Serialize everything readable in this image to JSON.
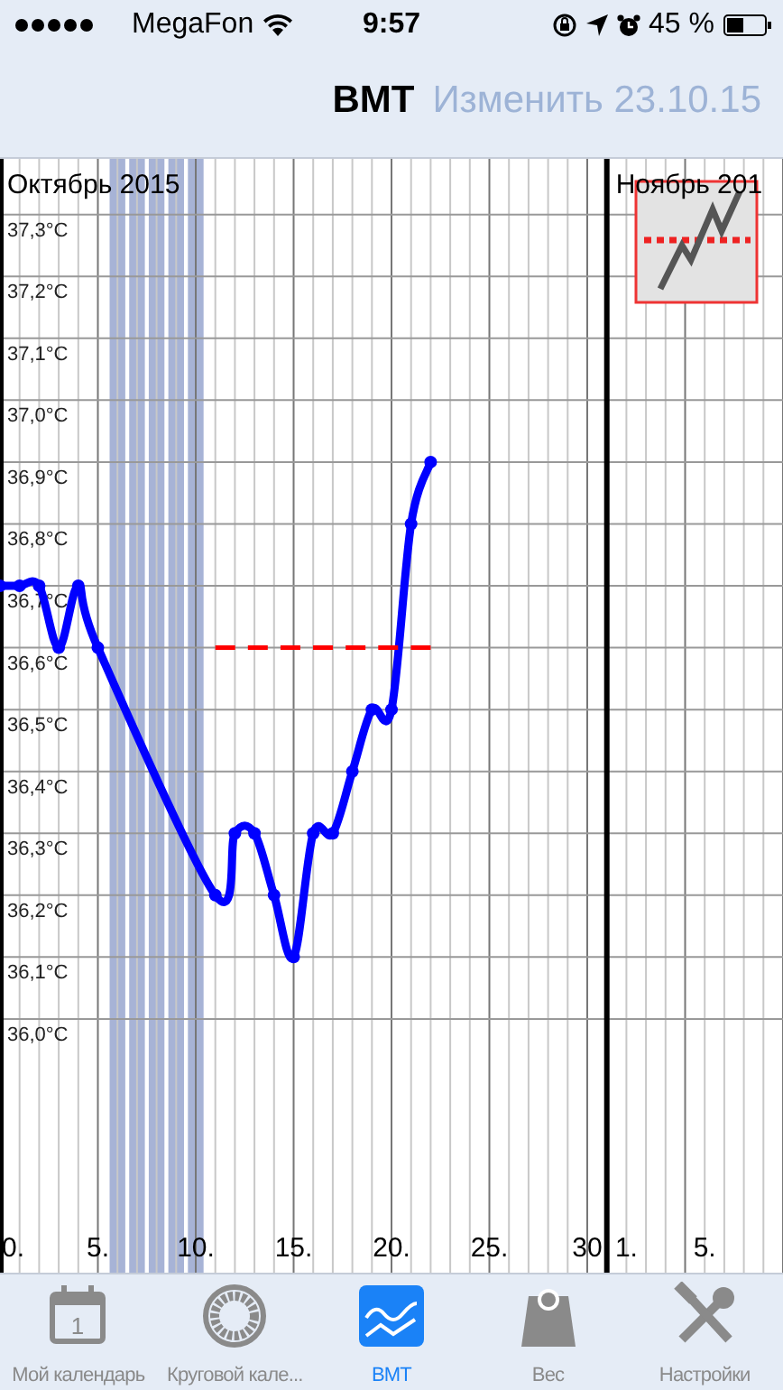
{
  "status_bar": {
    "carrier": "MegaFon",
    "time": "9:57",
    "battery": "45 %"
  },
  "nav": {
    "title": "BMT",
    "action": "Изменить 23.10.15"
  },
  "chart": {
    "months": [
      {
        "label": "Октябрь 2015"
      },
      {
        "label": "Ноябрь 201",
        "ticks": [
          "1.",
          "5."
        ]
      }
    ],
    "chart_data": {
      "type": "line",
      "grid": true,
      "x": [
        0,
        1,
        2,
        3,
        4,
        5,
        11,
        12,
        13,
        14,
        15,
        16,
        17,
        18,
        19,
        20,
        21,
        22
      ],
      "series": [
        {
          "color": "#0000ff",
          "marker": "o",
          "line_style": "solid",
          "values": [
            36.7,
            36.7,
            36.7,
            36.6,
            36.7,
            36.6,
            36.2,
            36.3,
            36.3,
            36.2,
            36.1,
            36.3,
            36.3,
            36.4,
            36.5,
            36.5,
            36.8,
            36.9
          ]
        },
        {
          "color": "#ff0000",
          "line_style": "dashed",
          "values": [
            null,
            null,
            null,
            null,
            null,
            null,
            36.6,
            36.6,
            36.6,
            36.6,
            36.6,
            36.6,
            36.6,
            36.6,
            36.6,
            36.6,
            36.6,
            36.6
          ]
        }
      ],
      "xlim": [
        0,
        40
      ],
      "ylim": [
        35.59,
        37.39
      ],
      "xticks": [
        {
          "value": 0,
          "label": "0."
        },
        {
          "value": 5,
          "label": "5."
        },
        {
          "value": 10,
          "label": "10."
        },
        {
          "value": 15,
          "label": "15."
        },
        {
          "value": 20,
          "label": "20."
        },
        {
          "value": 25,
          "label": "25."
        },
        {
          "value": 30,
          "label": "30"
        }
      ],
      "yticks": [
        {
          "value": 36.0,
          "label": "36,0°C"
        },
        {
          "value": 36.1,
          "label": "36,1°C"
        },
        {
          "value": 36.2,
          "label": "36,2°C"
        },
        {
          "value": 36.3,
          "label": "36,3°C"
        },
        {
          "value": 36.4,
          "label": "36,4°C"
        },
        {
          "value": 36.5,
          "label": "36,5°C"
        },
        {
          "value": 36.6,
          "label": "36,6°C"
        },
        {
          "value": 36.7,
          "label": "36,7°C"
        },
        {
          "value": 36.8,
          "label": "36,8°C"
        },
        {
          "value": 36.9,
          "label": "36,9°C"
        },
        {
          "value": 37.0,
          "label": "37,0°C"
        },
        {
          "value": 37.1,
          "label": "37,1°C"
        },
        {
          "value": 37.2,
          "label": "37,2°C"
        },
        {
          "value": 37.3,
          "label": "37,3°C"
        }
      ],
      "bands": [
        {
          "axis": "x",
          "from": 5.6,
          "to": 6.4,
          "color": "#a7b3d6"
        },
        {
          "axis": "x",
          "from": 6.6,
          "to": 7.4,
          "color": "#a7b3d6"
        },
        {
          "axis": "x",
          "from": 7.6,
          "to": 8.4,
          "color": "#a7b3d6"
        },
        {
          "axis": "x",
          "from": 8.6,
          "to": 9.4,
          "color": "#a7b3d6"
        },
        {
          "axis": "x",
          "from": 9.6,
          "to": 10.4,
          "color": "#a7b3d6"
        }
      ],
      "ref_lines": [
        {
          "axis": "x",
          "value": 31,
          "color": "#000000"
        }
      ]
    }
  },
  "tabs": [
    {
      "label": "Мой календарь",
      "kind": "calendar",
      "icon_label": "1",
      "selected": false
    },
    {
      "label": "Круговой кале...",
      "kind": "wheel",
      "selected": false
    },
    {
      "label": "BMT",
      "kind": "chart",
      "selected": true
    },
    {
      "label": "Вес",
      "kind": "scale",
      "selected": false
    },
    {
      "label": "Настройки",
      "kind": "tools",
      "selected": false
    }
  ]
}
